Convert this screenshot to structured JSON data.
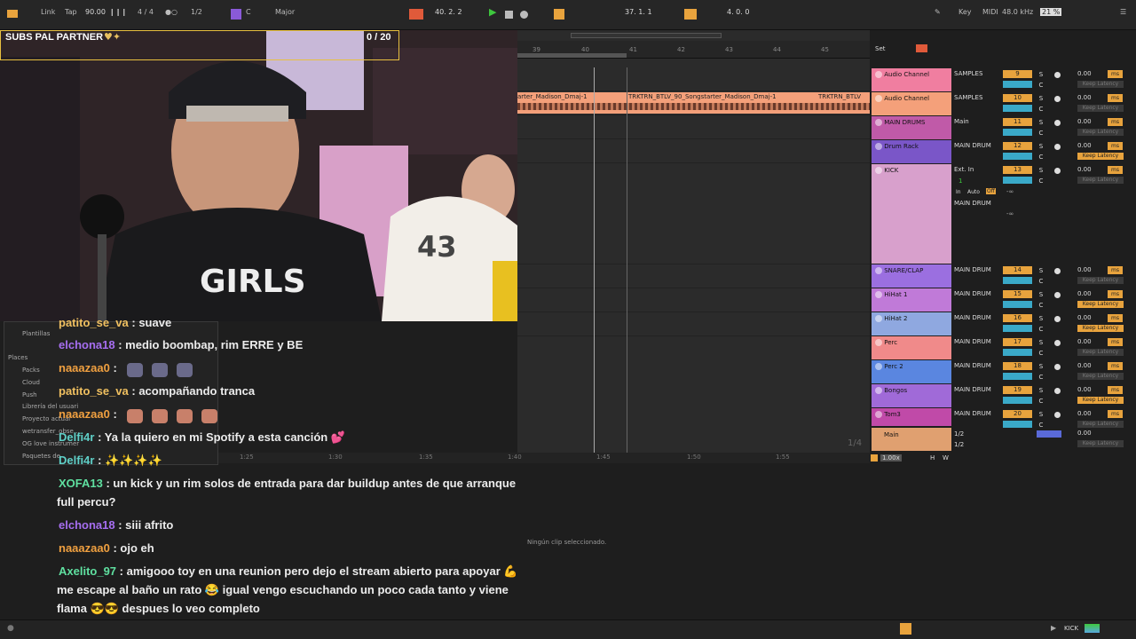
{
  "transport": {
    "link": "Link",
    "tap": "Tap",
    "tempo": "90.00",
    "time_sig": "4 / 4",
    "quantize": "1/2",
    "key_root": "C",
    "scale": "Major",
    "position": "40.  2.  2",
    "loop_start": "37.  1.  1",
    "loop_length": "4.  0.  0",
    "key_label": "Key",
    "midi_label": "MIDI",
    "sample_rate": "48.0 kHz",
    "cpu": "21 %"
  },
  "overlay": {
    "partner_text": "SUBS PAL PARTNER",
    "partner_count": "0  / 20"
  },
  "arrangement": {
    "ruler_bars": [
      "39",
      "40",
      "41",
      "42",
      "43",
      "44",
      "45"
    ],
    "set_label": "Set",
    "clip_labels": [
      "arter_Madison_Dmaj-1",
      "TRKTRN_BTLV_90_Songstarter_Madison_Dmaj-1",
      "TRKTRN_BTLV"
    ],
    "page": "1/4",
    "time_labels": [
      "1:25",
      "1:30",
      "1:35",
      "1:40",
      "1:45",
      "1:50",
      "1:55"
    ],
    "no_clip": "Ningún clip seleccionado."
  },
  "tracks": [
    {
      "name": "Audio Channel",
      "color": "#f07ea0",
      "io": "SAMPLES",
      "num": "9",
      "vol": "0.00",
      "lat": "Keep Latency",
      "lat_on": false
    },
    {
      "name": "Audio Channel",
      "color": "#f4a07a",
      "io": "SAMPLES",
      "num": "10",
      "vol": "0.00",
      "lat": "Keep Latency",
      "lat_on": false
    },
    {
      "name": "MAIN DRUMS",
      "color": "#c05aa8",
      "io": "Main",
      "num": "11",
      "vol": "0.00",
      "lat": "Keep Latency",
      "lat_on": false
    },
    {
      "name": "Drum Rack",
      "color": "#7a56c8",
      "io": "MAIN DRUM",
      "num": "12",
      "vol": "0.00",
      "lat": "Keep Latency",
      "lat_on": true
    },
    {
      "name": "KICK",
      "color": "#d8a0cc",
      "io": "Ext. In",
      "num": "13",
      "vol": "0.00",
      "lat": "Keep Latency",
      "lat_on": false
    },
    {
      "name": "SNARE/CLAP",
      "color": "#9b6fe0",
      "io": "MAIN DRUM",
      "num": "14",
      "vol": "0.00",
      "lat": "Keep Latency",
      "lat_on": false
    },
    {
      "name": "HiHat 1",
      "color": "#c07ad8",
      "io": "MAIN DRUM",
      "num": "15",
      "vol": "0.00",
      "lat": "Keep Latency",
      "lat_on": true
    },
    {
      "name": "HiHat 2",
      "color": "#8fa8e0",
      "io": "MAIN DRUM",
      "num": "16",
      "vol": "0.00",
      "lat": "Keep Latency",
      "lat_on": true
    },
    {
      "name": "Perc",
      "color": "#f08a8a",
      "io": "MAIN DRUM",
      "num": "17",
      "vol": "0.00",
      "lat": "Keep Latency",
      "lat_on": false
    },
    {
      "name": "Perc 2",
      "color": "#5a86e0",
      "io": "MAIN DRUM",
      "num": "18",
      "vol": "0.00",
      "lat": "Keep Latency",
      "lat_on": false
    },
    {
      "name": "Bongos",
      "color": "#a06ad8",
      "io": "MAIN DRUM",
      "num": "19",
      "vol": "0.00",
      "lat": "Keep Latency",
      "lat_on": true
    },
    {
      "name": "Tom3",
      "color": "#c04aa8",
      "io": "MAIN DRUM",
      "num": "20",
      "vol": "0.00",
      "lat": "Keep Latency",
      "lat_on": false
    }
  ],
  "kick_extra": {
    "input_ch": "1",
    "in": "In",
    "auto": "Auto",
    "off": "Off",
    "out": "MAIN DRUM",
    "inf": "-∞"
  },
  "main_track": {
    "name": "Main",
    "io1": "1/2",
    "io2": "1/2",
    "vol": "0.00",
    "lat": "Keep Latency"
  },
  "zoom": "1.00x",
  "hw": [
    "H",
    "W"
  ],
  "browser": {
    "items": [
      "Plantillas",
      "Places",
      "Packs",
      "Cloud",
      "Push",
      "Librería del usuari",
      "Proyecto actual",
      "wetransfer_obse...",
      "OG love instrumer",
      "Paquetes de"
    ]
  },
  "chat": [
    {
      "user": "patito_se_va",
      "text": "suave",
      "color": "#f0c060"
    },
    {
      "user": "elchona18",
      "text": "medio boombap, rim ERRE y BE",
      "color": "#a66ef0"
    },
    {
      "user": "naaazaa0",
      "text": "",
      "color": "#f0a040"
    },
    {
      "user": "patito_se_va",
      "text": "acompañando tranca",
      "color": "#f0c060"
    },
    {
      "user": "naaazaa0",
      "text": "",
      "color": "#f0a040"
    },
    {
      "user": "Delfi4r",
      "text": "Ya la quiero en mi Spotify a esta canción 💕",
      "color": "#5fd0c8"
    },
    {
      "user": "Delfi4r",
      "text": "✨✨✨✨",
      "color": "#5fd0c8"
    },
    {
      "user": "XOFA13",
      "text": "un kick y un rim solos de entrada para dar buildup antes de que arranque",
      "color": "#5fe0a0"
    },
    {
      "user": "",
      "text": "full percu?",
      "color": ""
    },
    {
      "user": "elchona18",
      "text": "siii afrito",
      "color": "#a66ef0"
    },
    {
      "user": "naaazaa0",
      "text": "ojo eh",
      "color": "#f0a040"
    },
    {
      "user": "Axelito_97",
      "text": "amigooo toy en una reunion pero dejo el stream abierto para apoyar 💪",
      "color": "#5fe0a0"
    },
    {
      "user": "",
      "text": "me escape al baño un rato 😂 igual vengo escuchando un poco cada tanto y viene",
      "color": ""
    },
    {
      "user": "",
      "text": "flama 😎😎 despues lo veo completo",
      "color": ""
    }
  ],
  "status": {
    "track": "KICK"
  }
}
